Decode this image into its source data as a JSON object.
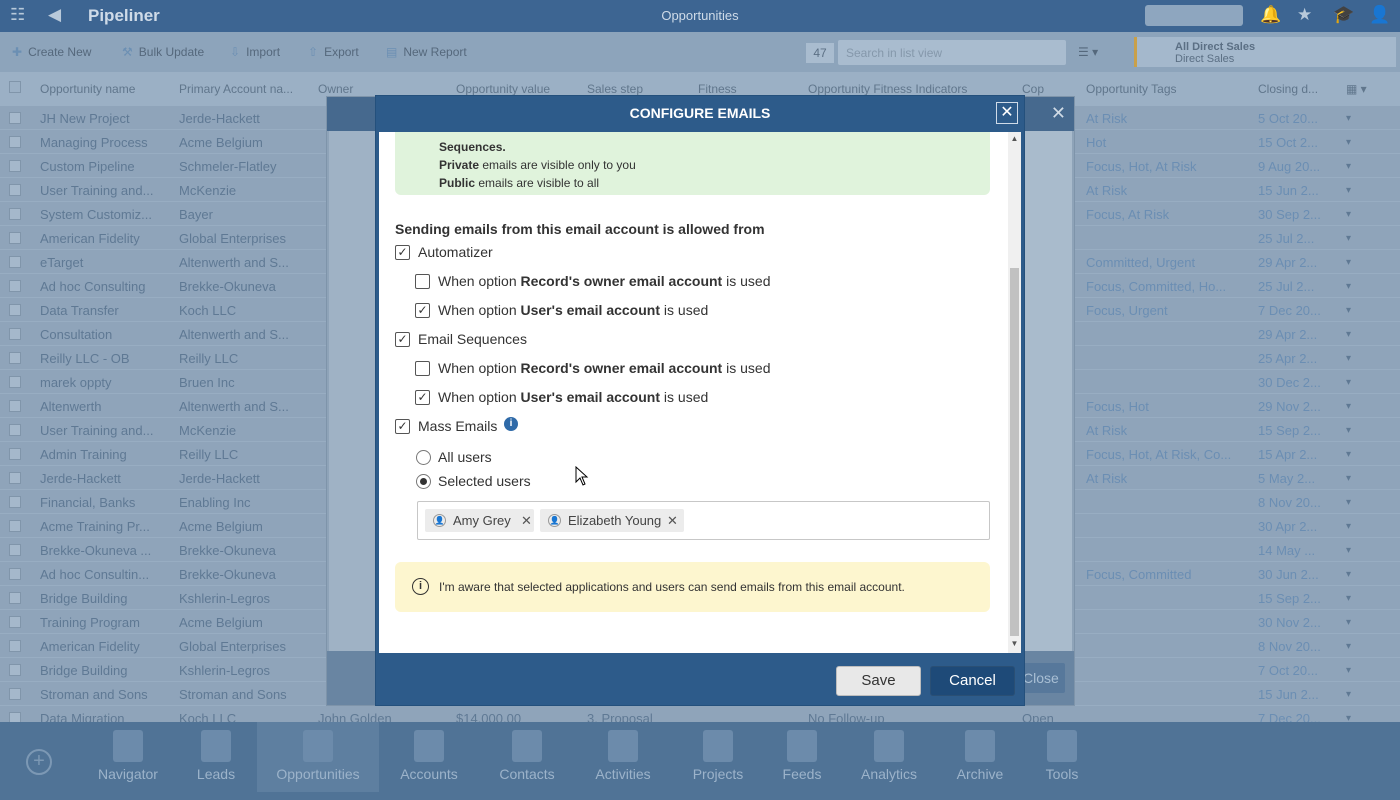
{
  "app": {
    "name": "Pipeliner",
    "title": "Opportunities"
  },
  "toolbar": {
    "create_new": "Create New",
    "bulk_update": "Bulk Update",
    "import": "Import",
    "export": "Export",
    "new_report": "New Report",
    "count": "47",
    "search_placeholder": "Search in list view",
    "view_title": "All Direct Sales",
    "view_subtitle": "Direct Sales"
  },
  "grid": {
    "headers": [
      "Opportunity name",
      "Primary Account na...",
      "Owner",
      "Opportunity value",
      "Sales step",
      "Fitness",
      "Opportunity Fitness Indicators",
      "Cop",
      "Opportunity Tags",
      "Closing d..."
    ],
    "rows": [
      {
        "name": "JH New Project",
        "account": "Jerde-Hackett",
        "tags": "At Risk",
        "close": "5 Oct 20..."
      },
      {
        "name": "Managing Process",
        "account": "Acme Belgium",
        "tags": "Hot",
        "close": "15 Oct 2..."
      },
      {
        "name": "Custom Pipeline",
        "account": "Schmeler-Flatley",
        "tags": "Focus, Hot, At Risk",
        "close": "9 Aug 20..."
      },
      {
        "name": "User Training and...",
        "account": "McKenzie",
        "tags": "At Risk",
        "close": "15 Jun 2..."
      },
      {
        "name": "System Customiz...",
        "account": "Bayer",
        "tags": "Focus, At Risk",
        "close": "30 Sep 2..."
      },
      {
        "name": "American Fidelity",
        "account": "Global Enterprises",
        "tags": "",
        "close": "25 Jul 2..."
      },
      {
        "name": "eTarget",
        "account": "Altenwerth and S...",
        "tags": "Committed, Urgent",
        "close": "29 Apr 2..."
      },
      {
        "name": "Ad hoc Consulting",
        "account": "Brekke-Okuneva",
        "tags": "Focus, Committed, Ho...",
        "close": "25 Jul 2..."
      },
      {
        "name": "Data Transfer",
        "account": "Koch LLC",
        "tags": "Focus, Urgent",
        "close": "7 Dec 20..."
      },
      {
        "name": "Consultation",
        "account": "Altenwerth and S...",
        "tags": "",
        "close": "29 Apr 2..."
      },
      {
        "name": "Reilly LLC - OB",
        "account": "Reilly LLC",
        "tags": "",
        "close": "25 Apr 2..."
      },
      {
        "name": "marek oppty",
        "account": "Bruen Inc",
        "tags": "",
        "close": "30 Dec 2..."
      },
      {
        "name": "Altenwerth",
        "account": "Altenwerth and S...",
        "tags": "Focus, Hot",
        "close": "29 Nov 2..."
      },
      {
        "name": "User Training and...",
        "account": "McKenzie",
        "tags": "At Risk",
        "close": "15 Sep 2..."
      },
      {
        "name": "Admin Training",
        "account": "Reilly LLC",
        "tags": "Focus, Hot, At Risk, Co...",
        "close": "15 Apr 2..."
      },
      {
        "name": "Jerde-Hackett",
        "account": "Jerde-Hackett",
        "tags": "At Risk",
        "close": "5 May 2..."
      },
      {
        "name": "Financial, Banks",
        "account": "Enabling Inc",
        "tags": "",
        "close": "8 Nov 20..."
      },
      {
        "name": "Acme Training Pr...",
        "account": "Acme Belgium",
        "tags": "",
        "close": "30 Apr 2..."
      },
      {
        "name": "Brekke-Okuneva ...",
        "account": "Brekke-Okuneva",
        "tags": "",
        "close": "14 May ..."
      },
      {
        "name": "Ad hoc Consultin...",
        "account": "Brekke-Okuneva",
        "tags": "Focus, Committed",
        "close": "30 Jun 2..."
      },
      {
        "name": "Bridge Building",
        "account": "Kshlerin-Legros",
        "tags": "",
        "close": "15 Sep 2..."
      },
      {
        "name": "Training Program",
        "account": "Acme Belgium",
        "tags": "",
        "close": "30 Nov 2..."
      },
      {
        "name": "American Fidelity",
        "account": "Global Enterprises",
        "tags": "",
        "close": "8 Nov 20..."
      },
      {
        "name": "Bridge Building",
        "account": "Kshlerin-Legros",
        "tags": "",
        "close": "7 Oct 20..."
      },
      {
        "name": "Stroman and Sons",
        "account": "Stroman and Sons",
        "tags": "",
        "close": "15 Jun 2..."
      },
      {
        "name": "Data Migration",
        "account": "Koch LLC",
        "tags": "",
        "close": "7 Dec 20..."
      }
    ],
    "last_row_extra": {
      "owner": "John Golden",
      "value": "$14,000.00",
      "step": "3. Proposal",
      "indicator": "No Follow-up",
      "cop": "Open"
    }
  },
  "bottom_nav": [
    "Navigator",
    "Leads",
    "Opportunities",
    "Accounts",
    "Contacts",
    "Activities",
    "Projects",
    "Feeds",
    "Analytics",
    "Archive",
    "Tools"
  ],
  "behind_dialog": {
    "close_button": "Close"
  },
  "modal": {
    "title": "CONFIGURE EMAILS",
    "info": {
      "line1": "Sequences.",
      "line2_bold": "Private",
      "line2_rest": " emails are visible only to you",
      "line3_bold": "Public",
      "line3_rest": " emails are visible to all"
    },
    "section_title": "Sending emails from this email account is allowed from",
    "option_prefix": "When option ",
    "option_suffix": " is used",
    "owner_account": "Record's owner email account",
    "user_account": "User's email account",
    "automatizer": {
      "label": "Automatizer",
      "checked": true,
      "owner_checked": false,
      "user_checked": true
    },
    "email_sequences": {
      "label": "Email Sequences",
      "checked": true,
      "owner_checked": false,
      "user_checked": true
    },
    "mass_emails": {
      "label": "Mass Emails",
      "checked": true
    },
    "radio_all": "All users",
    "radio_selected": "Selected users",
    "selected_mode": "selected",
    "users": [
      "Amy Grey",
      "Elizabeth Young"
    ],
    "notice": "I'm aware that selected applications and users can send emails from this email account.",
    "save": "Save",
    "cancel": "Cancel"
  },
  "colors": {
    "modal_header": "#2d5b8a",
    "cancel_bg": "#1e4a78",
    "info_green": "#e0f3dc",
    "info_yellow": "#fdf6cf"
  }
}
